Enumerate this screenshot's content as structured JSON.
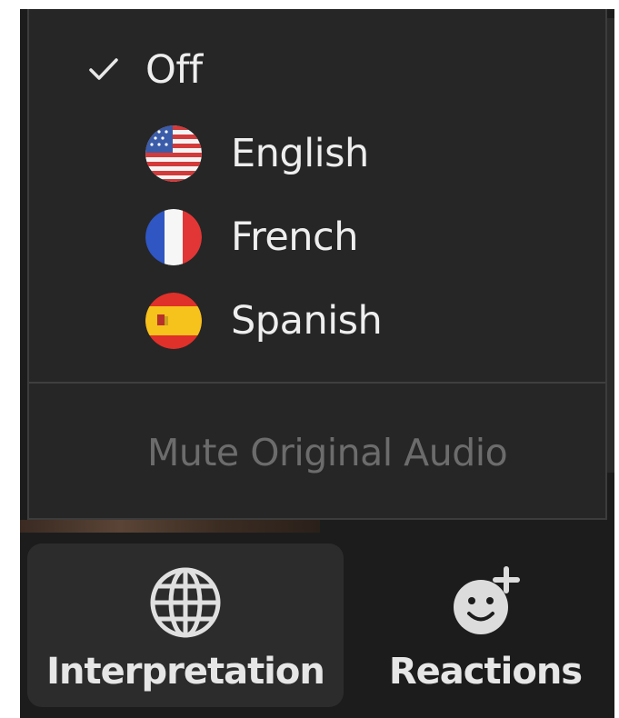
{
  "interpretation_menu": {
    "items": [
      {
        "label": "Off",
        "checked": true,
        "flag": null
      },
      {
        "label": "English",
        "checked": false,
        "flag": "us-flag-icon"
      },
      {
        "label": "French",
        "checked": false,
        "flag": "france-flag-icon"
      },
      {
        "label": "Spanish",
        "checked": false,
        "flag": "spain-flag-icon"
      }
    ],
    "mute_label": "Mute Original Audio",
    "mute_disabled": true
  },
  "toolbar": {
    "interpretation_label": "Interpretation",
    "interpretation_icon": "globe-icon",
    "reactions_label": "Reactions",
    "reactions_icon": "add-reaction-icon"
  },
  "colors": {
    "menu_background": "#262626",
    "text": "#eeeeee",
    "disabled_text": "#6c6c6c",
    "toolbar_background": "#1c1c1c"
  }
}
